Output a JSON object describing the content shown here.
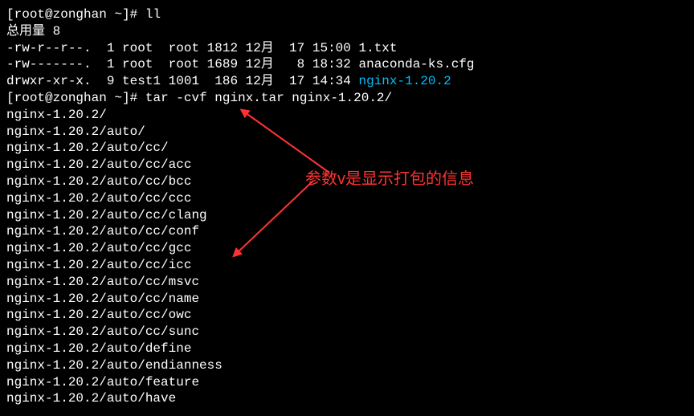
{
  "prompt1": {
    "user": "root",
    "host": "zonghan",
    "path": "~",
    "command": "ll"
  },
  "total_line": "总用量 8",
  "listing": [
    {
      "perms": "-rw-r--r--.",
      "links": "1",
      "owner": "root",
      "group": "root",
      "size": "1812",
      "month": "12月",
      "day": "17",
      "time": "15:00",
      "name": "1.txt",
      "is_dir": false
    },
    {
      "perms": "-rw-------.",
      "links": "1",
      "owner": "root",
      "group": "root",
      "size": "1689",
      "month": "12月",
      "day": "8",
      "time": "18:32",
      "name": "anaconda-ks.cfg",
      "is_dir": false
    },
    {
      "perms": "drwxr-xr-x.",
      "links": "9",
      "owner": "test1",
      "group": "1001",
      "size": "186",
      "month": "12月",
      "day": "17",
      "time": "14:34",
      "name": "nginx-1.20.2",
      "is_dir": true
    }
  ],
  "prompt2": {
    "user": "root",
    "host": "zonghan",
    "path": "~",
    "command": "tar -cvf nginx.tar nginx-1.20.2/"
  },
  "tar_output": [
    "nginx-1.20.2/",
    "nginx-1.20.2/auto/",
    "nginx-1.20.2/auto/cc/",
    "nginx-1.20.2/auto/cc/acc",
    "nginx-1.20.2/auto/cc/bcc",
    "nginx-1.20.2/auto/cc/ccc",
    "nginx-1.20.2/auto/cc/clang",
    "nginx-1.20.2/auto/cc/conf",
    "nginx-1.20.2/auto/cc/gcc",
    "nginx-1.20.2/auto/cc/icc",
    "nginx-1.20.2/auto/cc/msvc",
    "nginx-1.20.2/auto/cc/name",
    "nginx-1.20.2/auto/cc/owc",
    "nginx-1.20.2/auto/cc/sunc",
    "nginx-1.20.2/auto/define",
    "nginx-1.20.2/auto/endianness",
    "nginx-1.20.2/auto/feature",
    "nginx-1.20.2/auto/have"
  ],
  "annotation": {
    "text": "参数v是显示打包的信息",
    "color": "#ff3333"
  }
}
